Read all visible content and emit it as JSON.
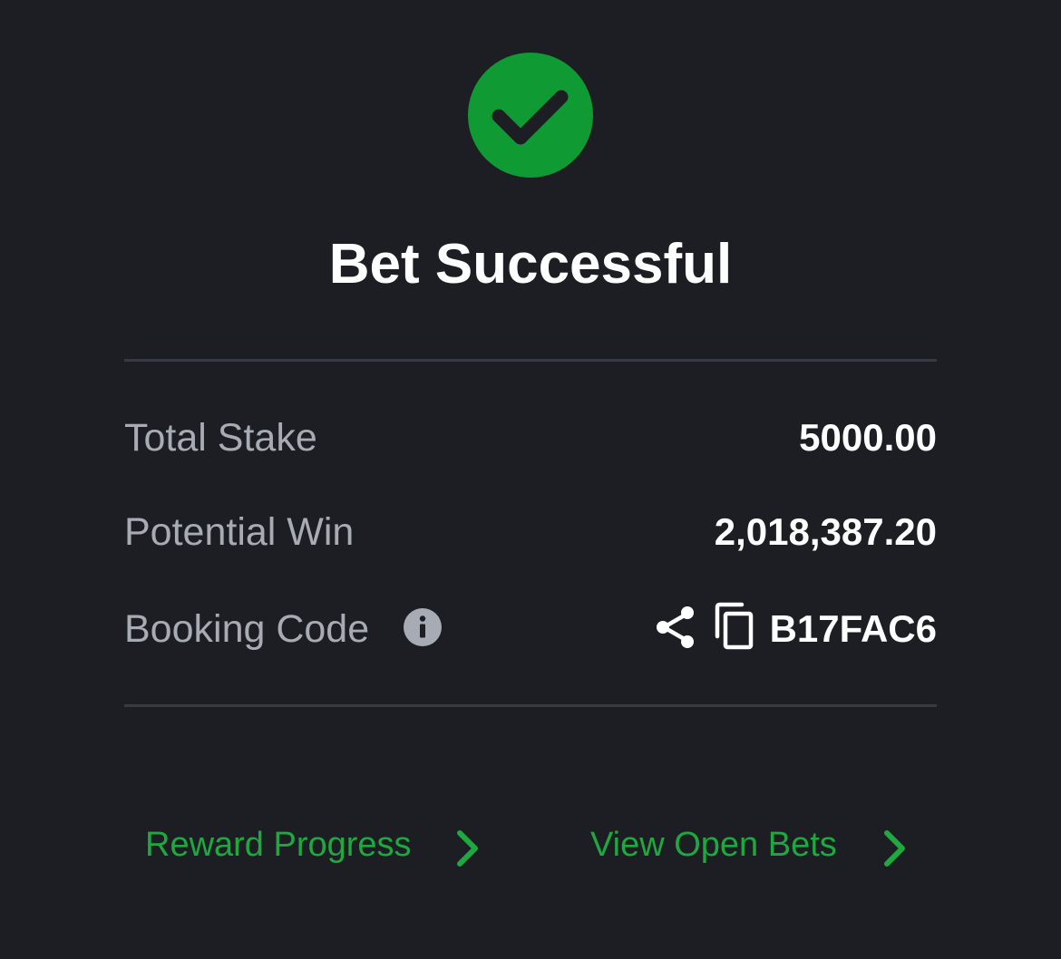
{
  "status": {
    "icon": "check-circle-icon",
    "title": "Bet Successful"
  },
  "summary": {
    "total_stake": {
      "label": "Total Stake",
      "value": "5000.00"
    },
    "potential_win": {
      "label": "Potential Win",
      "value": "2,018,387.20"
    },
    "booking_code": {
      "label": "Booking Code",
      "info_icon": "info-icon",
      "share_icon": "share-icon",
      "copy_icon": "copy-icon",
      "value": "B17FAC6"
    }
  },
  "links": {
    "reward_progress": {
      "label": "Reward Progress",
      "icon": "chevron-right-icon"
    },
    "view_open_bets": {
      "label": "View Open Bets",
      "icon": "chevron-right-icon"
    }
  },
  "colors": {
    "background": "#1c1e24",
    "success_green": "#109a33",
    "link_green": "#1fa83f",
    "label_gray": "#a7abb3",
    "divider": "#363a43",
    "value_white": "#ffffff"
  }
}
